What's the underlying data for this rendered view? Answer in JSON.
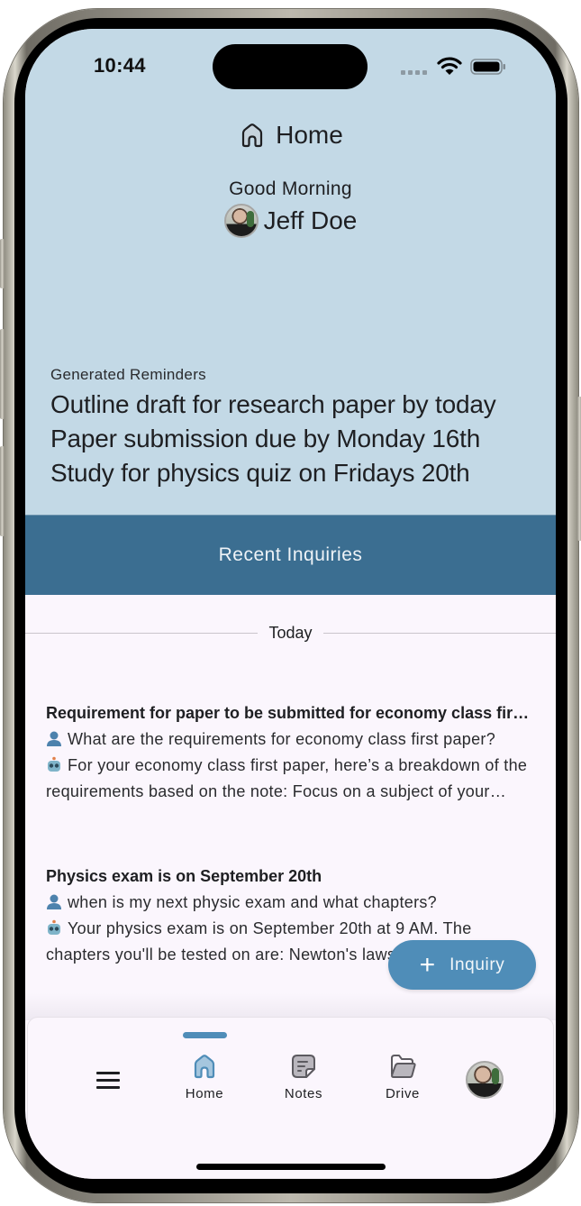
{
  "status_bar": {
    "time": "10:44",
    "icons": [
      "signal-dots-icon",
      "wifi-icon",
      "battery-icon"
    ]
  },
  "header": {
    "icon": "home-icon",
    "title": "Home",
    "greeting": "Good Morning",
    "user_name": "Jeff Doe"
  },
  "reminders": {
    "label": "Generated Reminders",
    "items": [
      "Outline draft for research paper by today",
      "Paper submission due by Monday 16th",
      "Study for physics quiz on Fridays 20th"
    ]
  },
  "recent_inquiries": {
    "title": "Recent Inquiries",
    "group_label": "Today",
    "items": [
      {
        "title": "Requirement for paper to be submitted for economy class first paper",
        "question": "What are the requirements for economy class first paper?",
        "answer": "For your economy class first paper, here’s a breakdown of the requirements based on the note: Focus on a subject of your choice"
      },
      {
        "title": "Physics exam is on September 20th",
        "question": "when is my next physic exam and what chapters?",
        "answer": "Your physics exam is on September 20th at 9 AM. The chapters you'll be tested on are: Newton's laws of motion"
      }
    ]
  },
  "fab": {
    "icon": "plus-icon",
    "label": "Inquiry"
  },
  "bottom_nav": {
    "menu_icon": "hamburger-menu-icon",
    "items": [
      {
        "label": "Home",
        "icon": "home-icon",
        "active": true
      },
      {
        "label": "Notes",
        "icon": "note-icon",
        "active": false
      },
      {
        "label": "Drive",
        "icon": "folder-icon",
        "active": false
      }
    ],
    "profile_icon": "profile-avatar"
  },
  "colors": {
    "header_bg": "#c3d9e6",
    "section_bar": "#3b6e91",
    "accent": "#4f8db8",
    "content_bg": "#fbf6fd"
  }
}
